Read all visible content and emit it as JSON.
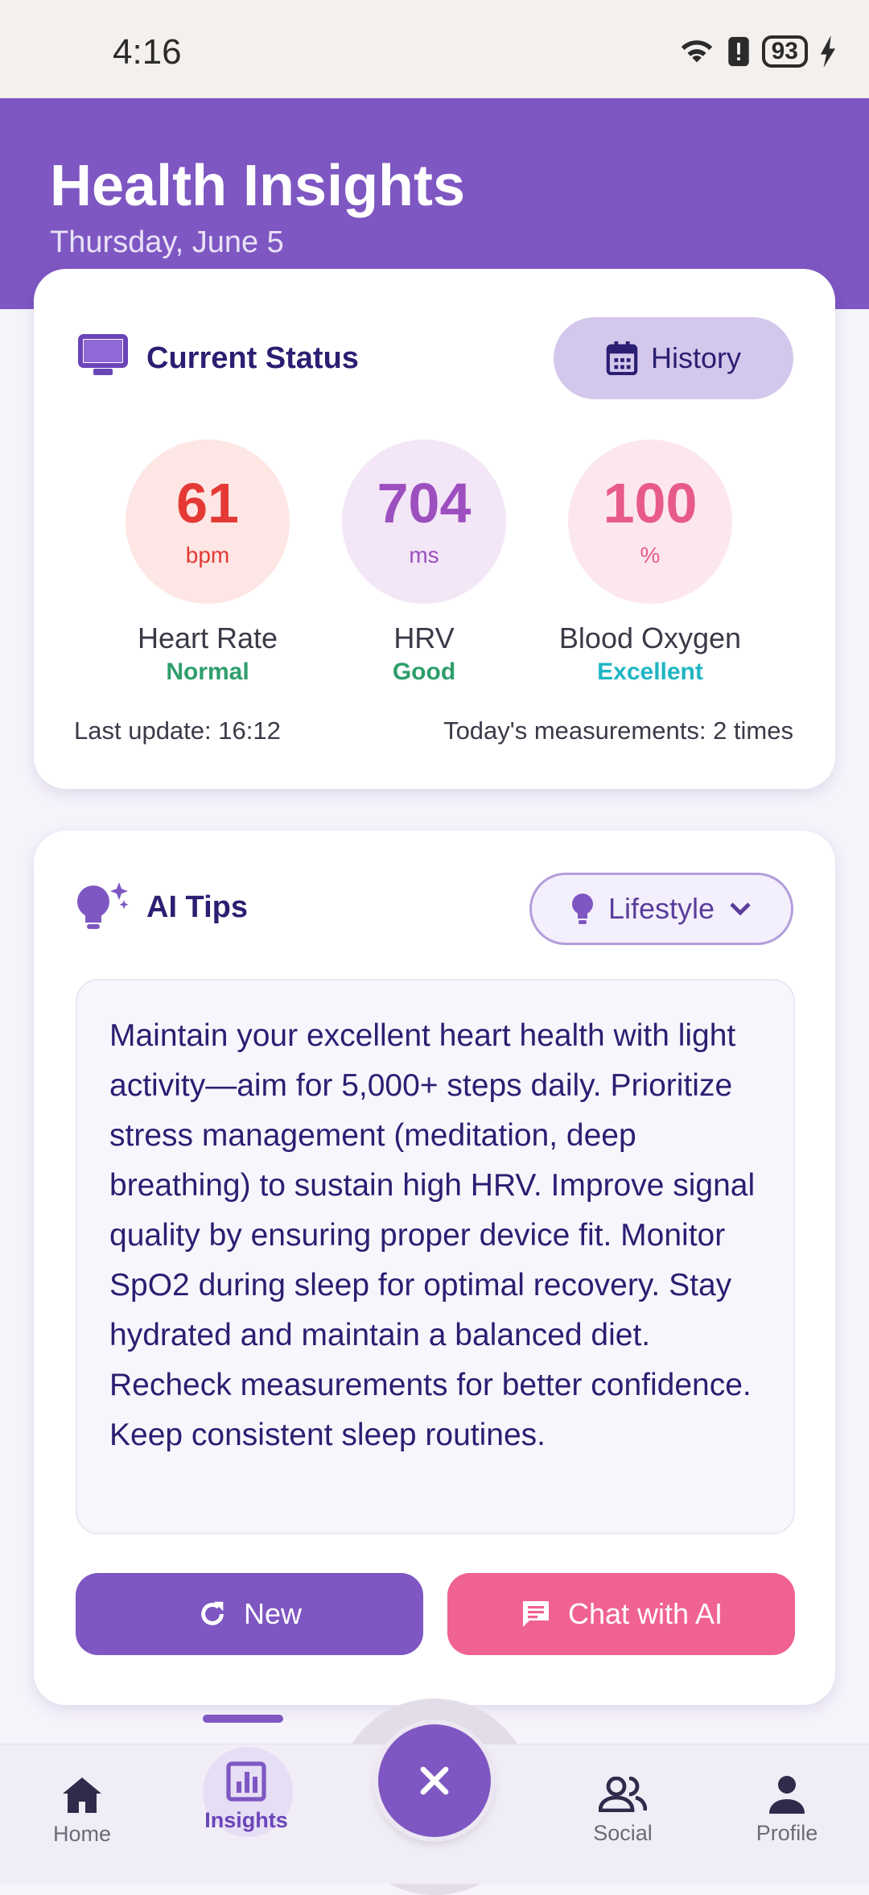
{
  "status_bar": {
    "time": "4:16",
    "battery": "93"
  },
  "header": {
    "title": "Health Insights",
    "date": "Thursday, June 5"
  },
  "current_status": {
    "title": "Current Status",
    "history_label": "History",
    "metrics": [
      {
        "value": "61",
        "unit": "bpm",
        "name": "Heart Rate",
        "status": "Normal"
      },
      {
        "value": "704",
        "unit": "ms",
        "name": "HRV",
        "status": "Good"
      },
      {
        "value": "100",
        "unit": "%",
        "name": "Blood Oxygen",
        "status": "Excellent"
      }
    ],
    "last_update": "Last update: 16:12",
    "measurements": "Today's measurements: 2 times"
  },
  "ai_tips": {
    "title": "AI Tips",
    "category": "Lifestyle",
    "text": "Maintain your excellent heart health with light activity—aim for 5,000+ steps daily. Prioritize stress management (meditation, deep breathing) to sustain high HRV. Improve signal quality by ensuring proper device fit. Monitor SpO2 during sleep for optimal recovery. Stay hydrated and maintain a balanced diet. Recheck measurements for better confidence. Keep consistent sleep routines.",
    "new_label": "New",
    "chat_label": "Chat with AI"
  },
  "nav": {
    "home": "Home",
    "insights": "Insights",
    "social": "Social",
    "profile": "Profile"
  },
  "colors": {
    "primary": "#7e57c2",
    "heart": "#e53935",
    "hrv": "#9c4fbf",
    "oxygen": "#e85a8a",
    "normal": "#2e9e6b",
    "excellent": "#1fb5c4",
    "chat": "#f06292"
  }
}
